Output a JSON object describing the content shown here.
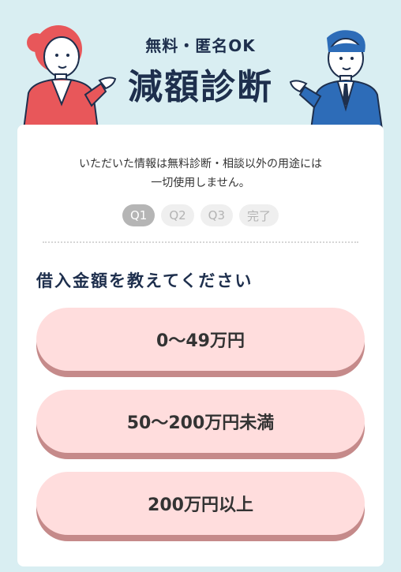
{
  "header": {
    "subtitle": "無料・匿名OK",
    "title": "減額診断"
  },
  "notice": {
    "line1": "いただいた情報は無料診断・相談以外の用途には",
    "line2": "一切使用しません。"
  },
  "steps": [
    {
      "label": "Q1",
      "active": true
    },
    {
      "label": "Q2",
      "active": false
    },
    {
      "label": "Q3",
      "active": false
    },
    {
      "label": "完了",
      "active": false
    }
  ],
  "question": "借入金額を教えてください",
  "options": [
    {
      "label": "0〜49万円"
    },
    {
      "label": "50〜200万円未満"
    },
    {
      "label": "200万円以上"
    }
  ],
  "colors": {
    "background": "#d9eef2",
    "title": "#1e2f4d",
    "option_fill": "#ffdddd",
    "option_shadow": "#c58a8a",
    "woman_suit": "#e8575a",
    "man_suit": "#2d6cb8"
  },
  "icons": [
    "businesswoman-illustration",
    "businessman-illustration"
  ]
}
